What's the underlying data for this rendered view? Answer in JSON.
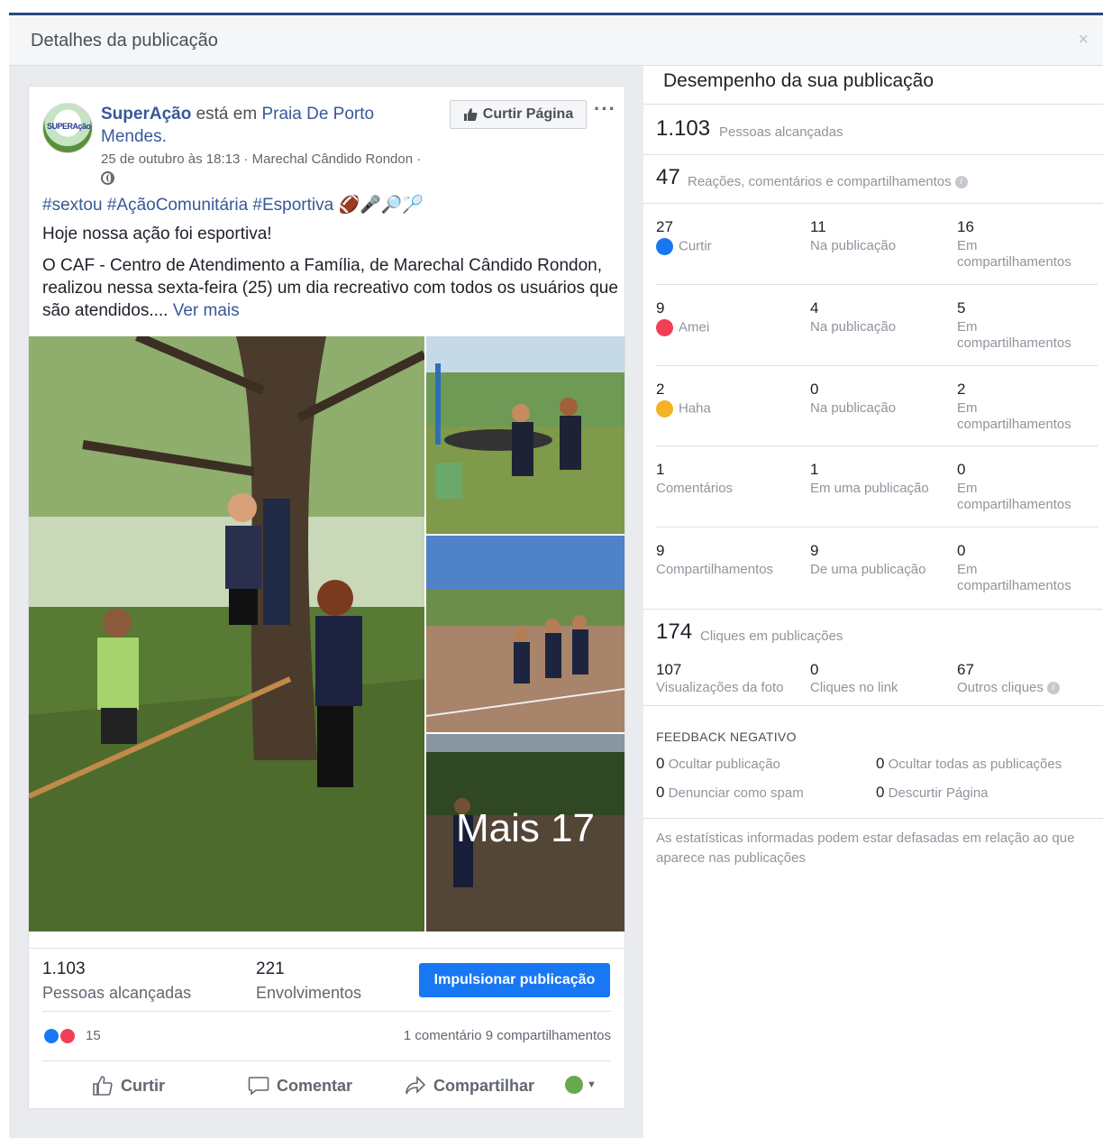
{
  "dialog": {
    "title": "Detalhes da publicação",
    "close": "×"
  },
  "post": {
    "page_name": "SuperAção",
    "is_at": " está em ",
    "place": "Praia De Porto Mendes.",
    "avatar_text": "SUPERAção",
    "date": "25 de outubro às 18:13 · Marechal Cândido Rondon ·",
    "like_page": "Curtir Página",
    "more": "···",
    "hashtags": "#sextou #AçãoComunitária #Esportiva 🏈🎤🔎🏸",
    "text1": "Hoje nossa ação foi esportiva!",
    "text2": "O CAF - Centro de Atendimento a Família, de Marechal Cândido Rondon, realizou nessa sexta-feira (25) um dia recreativo com todos os usuários que são atendidos....",
    "see_more": "Ver mais",
    "more_photos": "Mais 17",
    "reach_num": "1.103",
    "reach_lbl": "Pessoas alcançadas",
    "eng_num": "221",
    "eng_lbl": "Envolvimentos",
    "boost": "Impulsionar publicação",
    "reactions_count": "15",
    "comments_shares": "1 comentário  9 compartilhamentos",
    "actions": {
      "like": "Curtir",
      "comment": "Comentar",
      "share": "Compartilhar"
    }
  },
  "panel": {
    "title": "Desempenho da sua publicação",
    "reach": {
      "num": "1.103",
      "label": "Pessoas alcançadas"
    },
    "engagement": {
      "num": "47",
      "label": "Reações, comentários e compartilhamentos"
    },
    "rows": [
      {
        "c1n": "27",
        "c1l": "Curtir",
        "c2n": "11",
        "c2l": "Na publicação",
        "c3n": "16",
        "c3l": "Em compartilhamentos"
      },
      {
        "c1n": "9",
        "c1l": "Amei",
        "c2n": "4",
        "c2l": "Na publicação",
        "c3n": "5",
        "c3l": "Em compartilhamentos"
      },
      {
        "c1n": "2",
        "c1l": "Haha",
        "c2n": "0",
        "c2l": "Na publicação",
        "c3n": "2",
        "c3l": "Em compartilhamentos"
      },
      {
        "c1n": "1",
        "c1l": "Comentários",
        "c2n": "1",
        "c2l": "Em uma publicação",
        "c3n": "0",
        "c3l": "Em compartilhamentos"
      },
      {
        "c1n": "9",
        "c1l": "Compartilhamentos",
        "c2n": "9",
        "c2l": "De uma publicação",
        "c3n": "0",
        "c3l": "Em compartilhamentos"
      }
    ],
    "clicks": {
      "num": "174",
      "label": "Cliques em publicações"
    },
    "click_cells": [
      {
        "n": "107",
        "l": "Visualizações da foto"
      },
      {
        "n": "0",
        "l": "Cliques no link"
      },
      {
        "n": "67",
        "l": "Outros cliques"
      }
    ],
    "negative_title": "FEEDBACK NEGATIVO",
    "negative": [
      {
        "n": "0",
        "l": "Ocultar publicação"
      },
      {
        "n": "0",
        "l": "Ocultar todas as publicações"
      },
      {
        "n": "0",
        "l": "Denunciar como spam"
      },
      {
        "n": "0",
        "l": "Descurtir Página"
      }
    ],
    "disclaimer": "As estatísticas informadas podem estar defasadas em relação ao que aparece nas publicações"
  },
  "colors": {
    "accent": "#1877f2",
    "link": "#385898",
    "love": "#f33e58",
    "haha": "#f7b125"
  }
}
